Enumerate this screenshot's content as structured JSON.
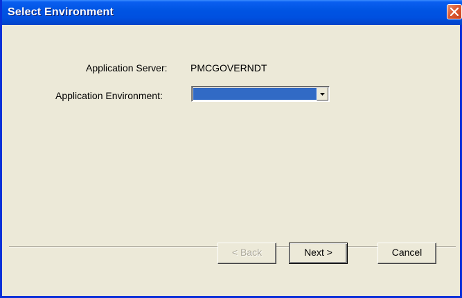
{
  "window": {
    "title": "Select Environment",
    "close_icon": "close-icon"
  },
  "form": {
    "server_label": "Application Server:",
    "server_value": "PMCGOVERNDT",
    "environment_label": "Application Environment:",
    "environment_value": "",
    "dropdown_icon": "chevron-down-icon"
  },
  "buttons": {
    "back_label": "< Back",
    "next_label": "Next >",
    "cancel_label": "Cancel"
  },
  "colors": {
    "titlebar": "#0054e3",
    "selection": "#316ac5",
    "dialog_bg": "#ece9d8",
    "close_button": "#dc5a32"
  }
}
